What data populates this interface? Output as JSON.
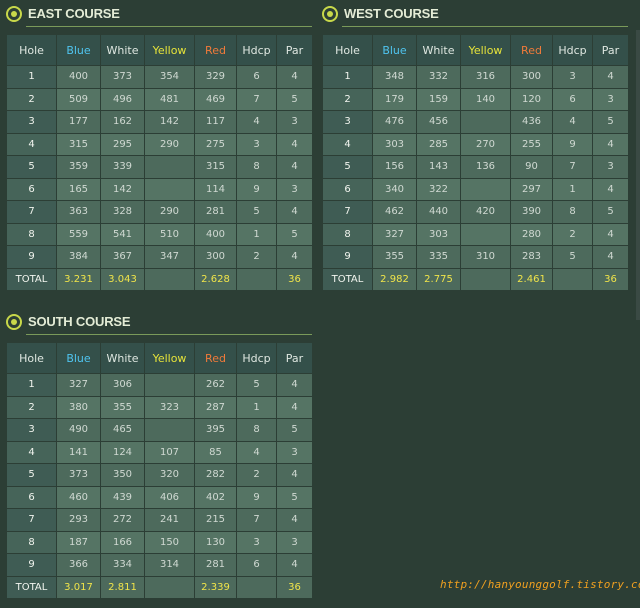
{
  "headers": [
    "Hole",
    "Blue",
    "White",
    "Yellow",
    "Red",
    "Hdcp",
    "Par"
  ],
  "courses": {
    "east": {
      "title": "EAST COURSE",
      "rows": [
        [
          "1",
          "400",
          "373",
          "354",
          "329",
          "6",
          "4"
        ],
        [
          "2",
          "509",
          "496",
          "481",
          "469",
          "7",
          "5"
        ],
        [
          "3",
          "177",
          "162",
          "142",
          "117",
          "4",
          "3"
        ],
        [
          "4",
          "315",
          "295",
          "290",
          "275",
          "3",
          "4"
        ],
        [
          "5",
          "359",
          "339",
          "",
          "315",
          "8",
          "4"
        ],
        [
          "6",
          "165",
          "142",
          "",
          "114",
          "9",
          "3"
        ],
        [
          "7",
          "363",
          "328",
          "290",
          "281",
          "5",
          "4"
        ],
        [
          "8",
          "559",
          "541",
          "510",
          "400",
          "1",
          "5"
        ],
        [
          "9",
          "384",
          "367",
          "347",
          "300",
          "2",
          "4"
        ]
      ],
      "total": [
        "TOTAL",
        "3.231",
        "3.043",
        "",
        "2.628",
        "",
        "36"
      ]
    },
    "west": {
      "title": "WEST COURSE",
      "rows": [
        [
          "1",
          "348",
          "332",
          "316",
          "300",
          "3",
          "4"
        ],
        [
          "2",
          "179",
          "159",
          "140",
          "120",
          "6",
          "3"
        ],
        [
          "3",
          "476",
          "456",
          "",
          "436",
          "4",
          "5"
        ],
        [
          "4",
          "303",
          "285",
          "270",
          "255",
          "9",
          "4"
        ],
        [
          "5",
          "156",
          "143",
          "136",
          "90",
          "7",
          "3"
        ],
        [
          "6",
          "340",
          "322",
          "",
          "297",
          "1",
          "4"
        ],
        [
          "7",
          "462",
          "440",
          "420",
          "390",
          "8",
          "5"
        ],
        [
          "8",
          "327",
          "303",
          "",
          "280",
          "2",
          "4"
        ],
        [
          "9",
          "355",
          "335",
          "310",
          "283",
          "5",
          "4"
        ]
      ],
      "total": [
        "TOTAL",
        "2.982",
        "2.775",
        "",
        "2.461",
        "",
        "36"
      ]
    },
    "south": {
      "title": "SOUTH COURSE",
      "rows": [
        [
          "1",
          "327",
          "306",
          "",
          "262",
          "5",
          "4"
        ],
        [
          "2",
          "380",
          "355",
          "323",
          "287",
          "1",
          "4"
        ],
        [
          "3",
          "490",
          "465",
          "",
          "395",
          "8",
          "5"
        ],
        [
          "4",
          "141",
          "124",
          "107",
          "85",
          "4",
          "3"
        ],
        [
          "5",
          "373",
          "350",
          "320",
          "282",
          "2",
          "4"
        ],
        [
          "6",
          "460",
          "439",
          "406",
          "402",
          "9",
          "5"
        ],
        [
          "7",
          "293",
          "272",
          "241",
          "215",
          "7",
          "4"
        ],
        [
          "8",
          "187",
          "166",
          "150",
          "130",
          "3",
          "3"
        ],
        [
          "9",
          "366",
          "334",
          "314",
          "281",
          "6",
          "4"
        ]
      ],
      "total": [
        "TOTAL",
        "3.017",
        "2.811",
        "",
        "2.339",
        "",
        "36"
      ]
    }
  },
  "watermark": "http://hanyounggolf.tistory.com",
  "colors": {
    "background": "#2c3e35",
    "blue": "#4fc4ef",
    "yellow": "#e6e33a",
    "red": "#f07a3a",
    "total": "#f0e44a",
    "accent": "#c8d84a"
  }
}
